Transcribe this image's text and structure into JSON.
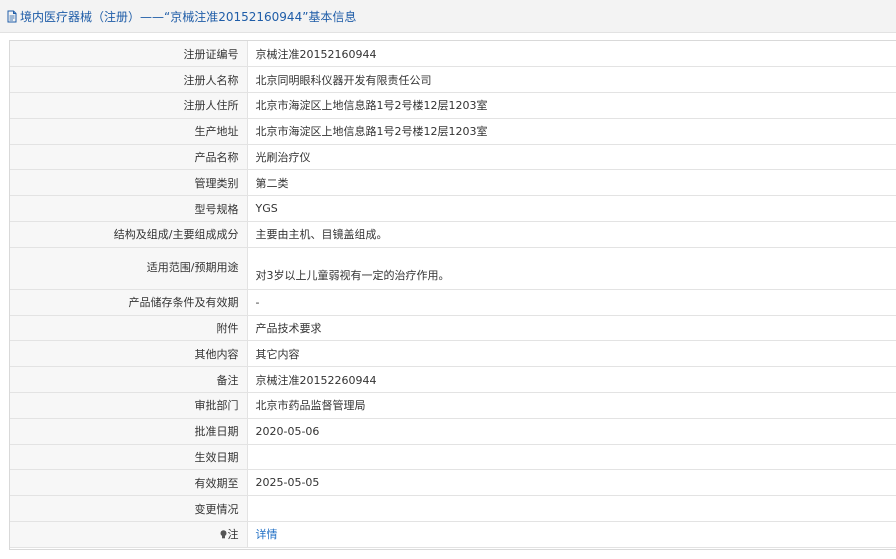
{
  "header": {
    "title": "境内医疗器械（注册）——“京械注准20152160944”基本信息"
  },
  "rows": [
    {
      "label": "注册证编号",
      "value": "京械注准20152160944"
    },
    {
      "label": "注册人名称",
      "value": "北京同明眼科仪器开发有限责任公司"
    },
    {
      "label": "注册人住所",
      "value": "北京市海淀区上地信息路1号2号楼12层1203室"
    },
    {
      "label": "生产地址",
      "value": "北京市海淀区上地信息路1号2号楼12层1203室"
    },
    {
      "label": "产品名称",
      "value": "光刷治疗仪"
    },
    {
      "label": "管理类别",
      "value": "第二类"
    },
    {
      "label": "型号规格",
      "value": "YGS"
    },
    {
      "label": "结构及组成/主要组成成分",
      "value": "主要由主机、目镜盖组成。"
    },
    {
      "label": "适用范围/预期用途",
      "value": "对3岁以上儿童弱视有一定的治疗作用。"
    },
    {
      "label": "产品储存条件及有效期",
      "value": "-"
    },
    {
      "label": "附件",
      "value": "产品技术要求"
    },
    {
      "label": "其他内容",
      "value": "其它内容"
    },
    {
      "label": "备注",
      "value": "京械注准20152260944"
    },
    {
      "label": "审批部门",
      "value": "北京市药品监督管理局"
    },
    {
      "label": "批准日期",
      "value": "2020-05-06"
    },
    {
      "label": "生效日期",
      "value": ""
    },
    {
      "label": "有效期至",
      "value": "2025-05-05"
    },
    {
      "label": "变更情况",
      "value": ""
    },
    {
      "label": "注",
      "value": "详情"
    }
  ],
  "icons": {
    "header": "document-icon",
    "note": "lightbulb-icon"
  },
  "colors": {
    "header_text": "#1f5da8",
    "link": "#1f6fc5",
    "label_bg": "#f7f7f7"
  }
}
